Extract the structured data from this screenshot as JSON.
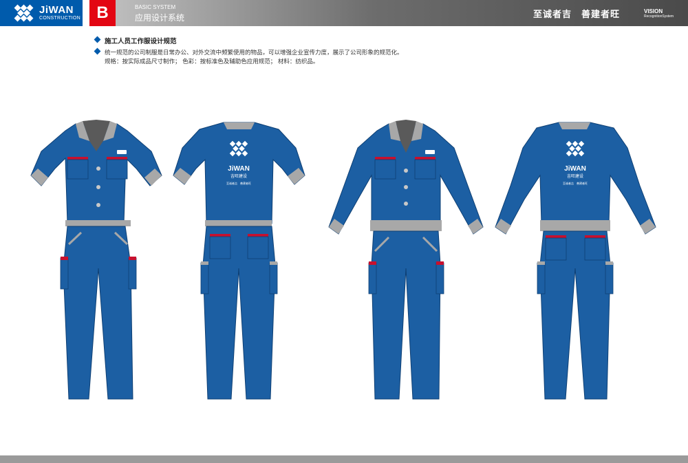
{
  "header": {
    "brand_name": "JiWAN",
    "brand_sub": "CONSTRUCTION",
    "section_letter": "B",
    "system_en": "BASIC SYSTEM",
    "system_cn": "应用设计系统",
    "slogan": "至诚者吉　善建者旺",
    "vision": "VISION",
    "vision_sub": "RecognitionSystem"
  },
  "content": {
    "title": "施工人员工作服设计规范",
    "description": "统一规范的公司制服是日常办公、对外交流中频繁使用的物品，可以增强企业宣传力度，展示了公司形象的规范化。",
    "spec": "规格：按实际成品尺寸制作；  色彩：按标准色及辅助色应用规范；  材料：纺织品。"
  },
  "garments": {
    "back_brand": "JiWAN",
    "back_brand_cn": "吉旺建设",
    "back_slogan": "至诚者吉　善建者旺",
    "chest_badge": "JiWAN"
  },
  "colors": {
    "primary_blue": "#005bac",
    "garment_blue": "#1c5fa3",
    "accent_red": "#e30613",
    "trim_gray": "#a8a8a8"
  }
}
